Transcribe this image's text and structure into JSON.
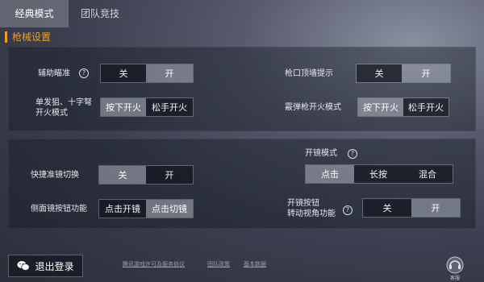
{
  "tabs": [
    {
      "label": "经典模式",
      "active": true
    },
    {
      "label": "团队竞技",
      "active": false
    }
  ],
  "section_title": "枪械设置",
  "panel1": {
    "aim_assist": {
      "label": "辅助瞄准",
      "options": [
        "关",
        "开"
      ],
      "selected": "开"
    },
    "muzzle_hint": {
      "label": "枪口顶墙提示",
      "options": [
        "关",
        "开"
      ],
      "selected": "开"
    },
    "single_fire": {
      "label_line1": "单发狙、十字弩",
      "label_line2": "开火模式",
      "options": [
        "按下开火",
        "松手开火"
      ],
      "selected": "按下开火"
    },
    "shotgun_fire": {
      "label": "霰弹枪开火模式",
      "options": [
        "按下开火",
        "松手开火"
      ],
      "selected": "按下开火"
    }
  },
  "panel2": {
    "scope_mode": {
      "label": "开镜模式",
      "options": [
        "点击",
        "长按",
        "混合"
      ],
      "selected": "点击"
    },
    "quick_scope": {
      "label": "快捷准镜切换",
      "options": [
        "关",
        "开"
      ],
      "selected": "关"
    },
    "side_scope": {
      "label": "侧面镜按钮功能",
      "options": [
        "点击开镜",
        "点击切镜"
      ],
      "selected": "点击切镜"
    },
    "scope_button_rotate": {
      "label_line1": "开镜按钮",
      "label_line2": "转动视角功能",
      "options": [
        "关",
        "开"
      ],
      "selected": "开"
    }
  },
  "footer": {
    "logout_label": "退出登录",
    "links": [
      "腾讯游戏许可及服务协议",
      "团队政策",
      "基本数据"
    ],
    "service_label": "客服"
  },
  "colors": {
    "accent": "#f0a020",
    "selected_bg": "#8c929c",
    "unselected_bg": "#1a1e28"
  },
  "icons": [
    "question-icon",
    "wechat-icon",
    "headset-icon"
  ]
}
